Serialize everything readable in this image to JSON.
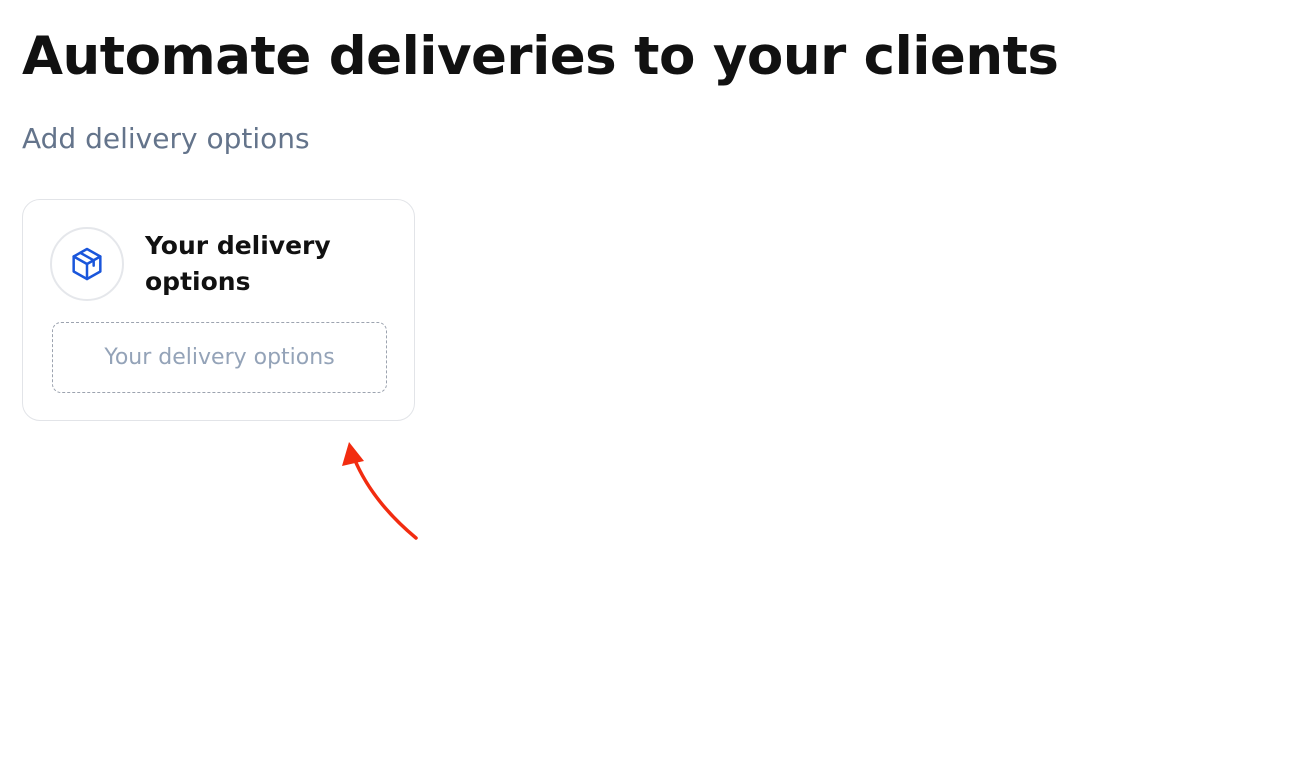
{
  "header": {
    "title": "Automate deliveries to your clients",
    "subtitle": "Add delivery options"
  },
  "card": {
    "icon": "package-box-icon",
    "title": "Your delivery options",
    "drop_zone_label": "Your delivery options"
  },
  "colors": {
    "icon_blue": "#1a56db",
    "arrow_red": "#f22c10",
    "subtitle_gray": "#64748b",
    "placeholder_gray": "#94a3b8"
  }
}
